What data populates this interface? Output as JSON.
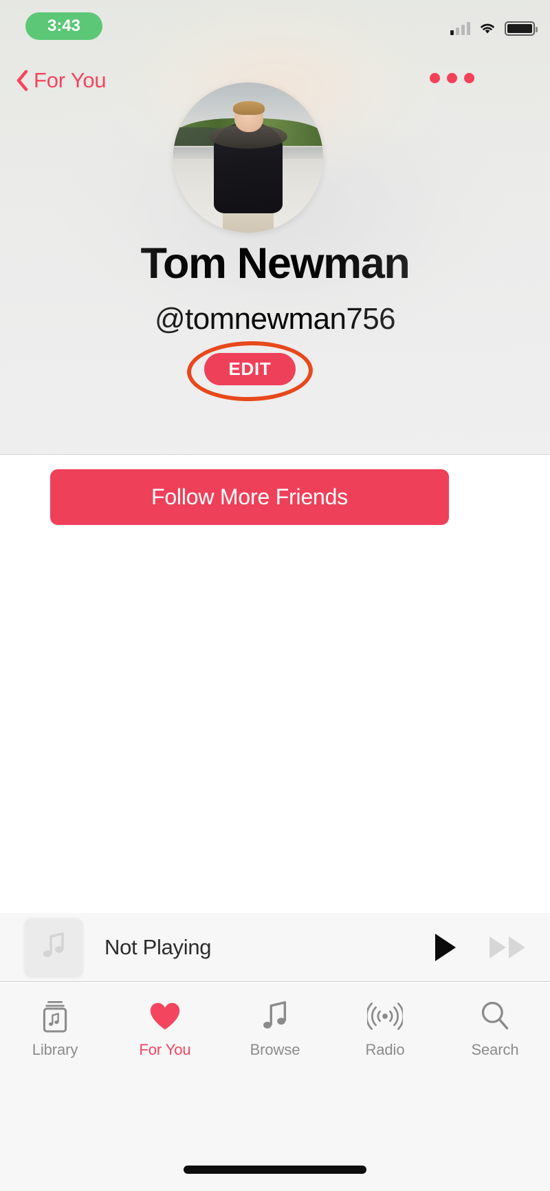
{
  "status_bar": {
    "time": "3:43",
    "time_pill_color": "#5BC777",
    "signal_icon": "cellular-signal-icon",
    "wifi_icon": "wifi-icon",
    "battery_icon": "battery-icon"
  },
  "nav": {
    "back_label": "For You",
    "back_icon": "chevron-left-icon",
    "more_icon": "more-options-icon",
    "accent_color": "#F4455F"
  },
  "profile": {
    "avatar_icon": "avatar",
    "display_name": "Tom Newman",
    "handle": "@tomnewman756",
    "edit_label": "EDIT",
    "edit_button_color": "#EF4059",
    "annotation_color": "#E8481B"
  },
  "content": {
    "follow_label": "Follow More Friends",
    "follow_button_color": "#EF4059"
  },
  "mini_player": {
    "album_art_icon": "music-note-icon",
    "status_text": "Not Playing",
    "play_icon": "play-icon",
    "forward_icon": "fast-forward-icon"
  },
  "tab_bar": {
    "items": [
      {
        "label": "Library",
        "icon": "library-icon",
        "active": false
      },
      {
        "label": "For You",
        "icon": "heart-icon",
        "active": true
      },
      {
        "label": "Browse",
        "icon": "music-note-icon",
        "active": false
      },
      {
        "label": "Radio",
        "icon": "radio-waves-icon",
        "active": false
      },
      {
        "label": "Search",
        "icon": "search-icon",
        "active": false
      }
    ],
    "active_color": "#F4455F",
    "inactive_color": "#8B8B8B"
  }
}
